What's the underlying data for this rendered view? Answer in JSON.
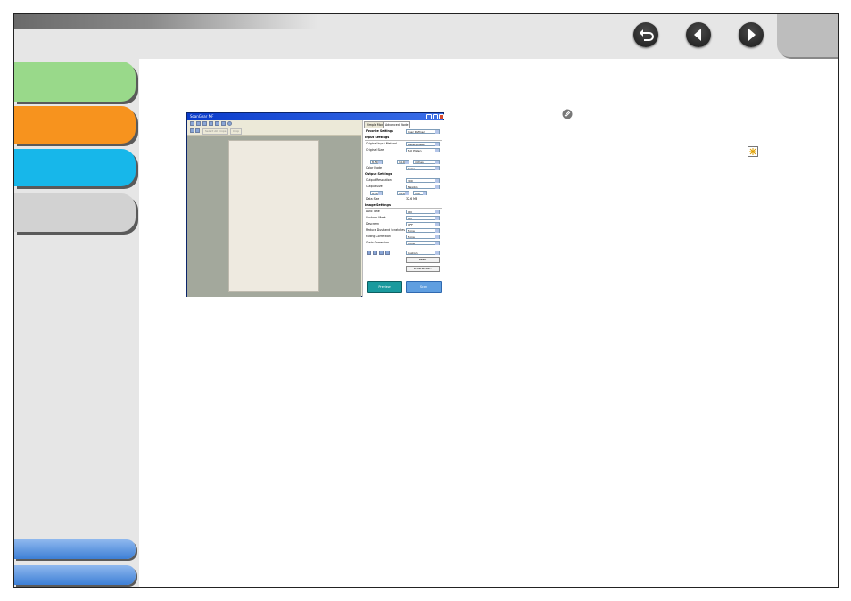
{
  "nav": {
    "back_icon": "return-arrow-icon",
    "prev_icon": "left-triangle-icon",
    "next_icon": "right-triangle-icon"
  },
  "colors": {
    "tab_green": "#99d98a",
    "tab_orange": "#f7931e",
    "tab_blue": "#17b7ea",
    "tab_gray": "#d2d2d2",
    "bottom_button": "#3d7fd6"
  },
  "screenshot": {
    "title": "ScanGear MF",
    "toolbar2": {
      "select_all_crops": "Select All Crops",
      "crop": "Crop"
    },
    "tabs": [
      "Simple Mode",
      "Advanced Mode"
    ],
    "favorite_settings": {
      "label": "Favorite Settings",
      "value": "User Defined"
    },
    "input_settings": {
      "heading": "Input Settings",
      "rows": [
        {
          "label": "Original Input Method",
          "value": "Platen/Glass"
        },
        {
          "label": "Original Size",
          "value": "Full Platen"
        }
      ],
      "size": {
        "w": "8.50",
        "h": "14.00",
        "unit": "inches"
      },
      "color_mode": {
        "label": "Color Mode",
        "value": "Color"
      }
    },
    "output_settings": {
      "heading": "Output Settings",
      "rows": [
        {
          "label": "Output Resolution",
          "value": "300"
        },
        {
          "label": "Output Size",
          "value": "Flexible"
        }
      ],
      "size": {
        "w": "8.50",
        "h": "14.00",
        "scale": "100"
      },
      "data_size": {
        "label": "Data Size",
        "value": "32.6 MB"
      }
    },
    "image_settings": {
      "heading": "Image Settings",
      "rows": [
        {
          "label": "Auto Tone",
          "value": "ON"
        },
        {
          "label": "Unsharp Mask",
          "value": "ON"
        },
        {
          "label": "Descreen",
          "value": "OFF"
        },
        {
          "label": "Reduce Dust and Scratches",
          "value": "None"
        },
        {
          "label": "Fading Correction",
          "value": "None"
        },
        {
          "label": "Grain Correction",
          "value": "None"
        }
      ]
    },
    "tone_preset": "Custom",
    "reset_label": "Reset",
    "preferences_label": "Preferences...",
    "preview_label": "Preview",
    "scan_label": "Scan"
  }
}
